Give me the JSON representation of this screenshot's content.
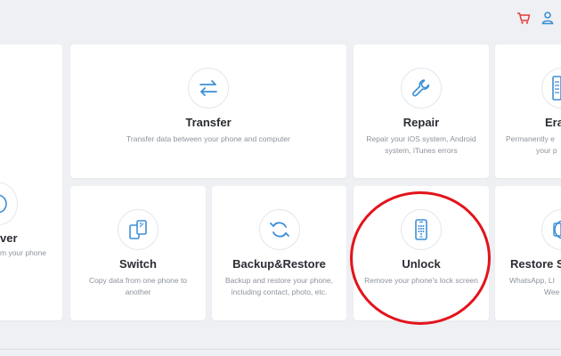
{
  "header": {
    "cart_icon": "cart-icon",
    "user_icon": "user-icon",
    "accent_color": "#3d8fd6",
    "cart_color": "#e53935"
  },
  "cards": {
    "recover": {
      "title": "ver",
      "desc": "m your phone"
    },
    "transfer": {
      "title": "Transfer",
      "desc": "Transfer data between your phone and computer"
    },
    "repair": {
      "title": "Repair",
      "desc": "Repair your iOS system, Android system, iTunes errors"
    },
    "erase": {
      "title": "Era",
      "desc_line1": "Permanently e",
      "desc_line2": "your p"
    },
    "switch": {
      "title": "Switch",
      "desc": "Copy data from one phone to another"
    },
    "backup": {
      "title": "Backup&Restore",
      "desc": "Backup and restore your phone, including contact, photo, etc."
    },
    "unlock": {
      "title": "Unlock",
      "desc": "Remove your phone's lock screen"
    },
    "restore_social": {
      "title": "Restore S",
      "desc_line1": "WhatsApp, LI",
      "desc_line2": "Wee"
    }
  },
  "annotation": {
    "circle_color": "#e3131b",
    "target": "Unlock"
  }
}
